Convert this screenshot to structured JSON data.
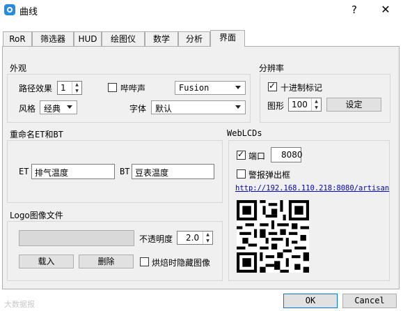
{
  "window": {
    "title": "曲线",
    "help_label": "?",
    "close_label": "✕"
  },
  "tabs": [
    {
      "label": "RoR"
    },
    {
      "label": "筛选器"
    },
    {
      "label": "HUD"
    },
    {
      "label": "绘图仪"
    },
    {
      "label": "数学"
    },
    {
      "label": "分析"
    },
    {
      "label": "界面",
      "active": true
    }
  ],
  "appearance": {
    "title": "外观",
    "path_effect_label": "路径效果",
    "path_effect_value": "1",
    "beep_label": "哔哔声",
    "beep_checked": false,
    "fusion_value": "Fusion",
    "style_label": "风格",
    "style_value": "经典",
    "font_label": "字体",
    "font_value": "默认"
  },
  "resolution": {
    "title": "分辨率",
    "decimal_label": "十进制标记",
    "decimal_checked": true,
    "graph_label": "图形",
    "graph_value": "100",
    "set_button": "设定"
  },
  "rename": {
    "title": "重命名ET和BT",
    "et_label": "ET",
    "et_value": "排气温度",
    "bt_label": "BT",
    "bt_value": "豆表温度"
  },
  "weblcds": {
    "title": "WebLCDs",
    "port_label": "端口",
    "port_checked": true,
    "port_value": "8080",
    "alarm_label": "警报弹出框",
    "alarm_checked": false,
    "url": "http://192.168.110.218:8080/artisan"
  },
  "logo": {
    "title": "Logo图像文件",
    "opacity_label": "不透明度",
    "opacity_value": "2.0",
    "load_button": "载入",
    "delete_button": "删除",
    "hide_label": "烘焙时隐藏图像",
    "hide_checked": false
  },
  "footer": {
    "ok_button": "OK",
    "cancel_button": "Cancel",
    "watermark": "大数据报"
  },
  "colors": {
    "link": "#0000cc",
    "accent": "#2a8bd8"
  }
}
